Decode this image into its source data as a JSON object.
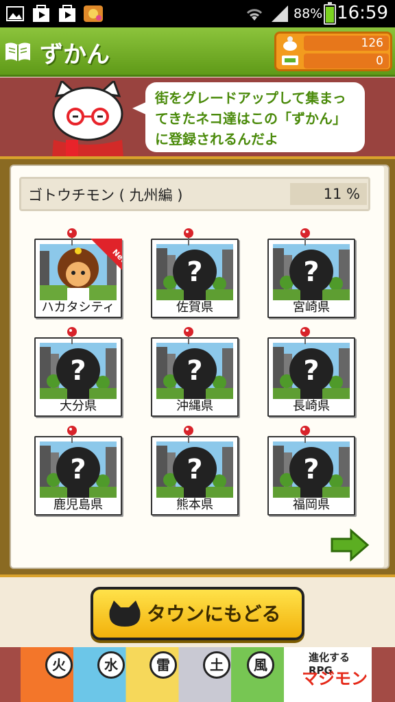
{
  "status_bar": {
    "battery_pct": "88%",
    "time": "16:59"
  },
  "header": {
    "title": "ずかん",
    "coins": "126",
    "gems": "0"
  },
  "hint": {
    "text": "街をグレードアップして集まってきたネコ達はこの「ずかん」に登録されるんだよ"
  },
  "collection": {
    "name": "ゴトウチモン ( 九州編 )",
    "percent": "11 %",
    "new_badge": "New",
    "cards": [
      {
        "label": "ハカタシティ",
        "unlocked": true
      },
      {
        "label": "佐賀県",
        "unlocked": false
      },
      {
        "label": "宮崎県",
        "unlocked": false
      },
      {
        "label": "大分県",
        "unlocked": false
      },
      {
        "label": "沖縄県",
        "unlocked": false
      },
      {
        "label": "長崎県",
        "unlocked": false
      },
      {
        "label": "鹿児島県",
        "unlocked": false
      },
      {
        "label": "熊本県",
        "unlocked": false
      },
      {
        "label": "福岡県",
        "unlocked": false
      }
    ]
  },
  "buttons": {
    "town": "タウンにもどる"
  },
  "ad": {
    "elements": [
      "火",
      "水",
      "雷",
      "",
      "土",
      "風"
    ],
    "subtitle": "進化するRPG",
    "title": "マジモン"
  },
  "colors": {
    "header_green": "#7cb82f",
    "banner_red": "#99433f",
    "button_yellow": "#f7c21a"
  }
}
